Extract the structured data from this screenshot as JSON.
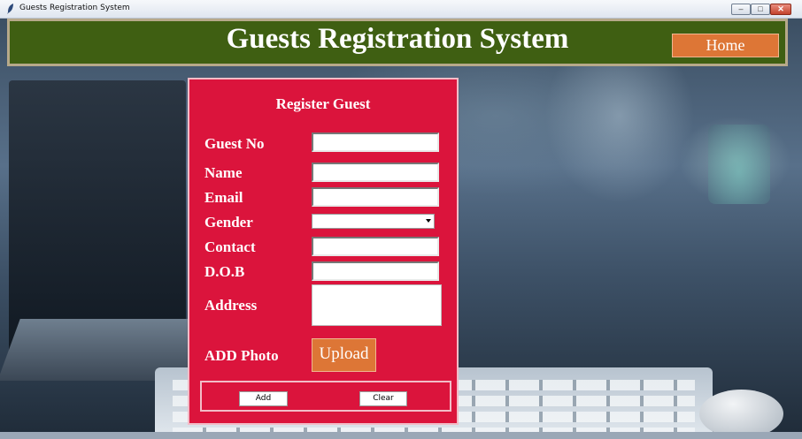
{
  "window": {
    "title": "Guests Registration System",
    "controls": {
      "minimize": "–",
      "maximize": "□",
      "close": "✕"
    }
  },
  "header": {
    "title": "Guests Registration System",
    "home_label": "Home"
  },
  "form": {
    "title": "Register Guest",
    "labels": {
      "guest_no": "Guest No",
      "name": "Name",
      "email": "Email",
      "gender": "Gender",
      "contact": "Contact",
      "dob": "D.O.B",
      "address": "Address",
      "photo": "ADD Photo"
    },
    "values": {
      "guest_no": "",
      "name": "",
      "email": "",
      "gender": "",
      "contact": "",
      "dob": "",
      "address": ""
    },
    "upload_label": "Upload",
    "add_label": "Add",
    "clear_label": "Clear"
  },
  "colors": {
    "header_bg": "#3f5f12",
    "panel_bg": "#db143c",
    "button_orange": "#dd7636"
  }
}
